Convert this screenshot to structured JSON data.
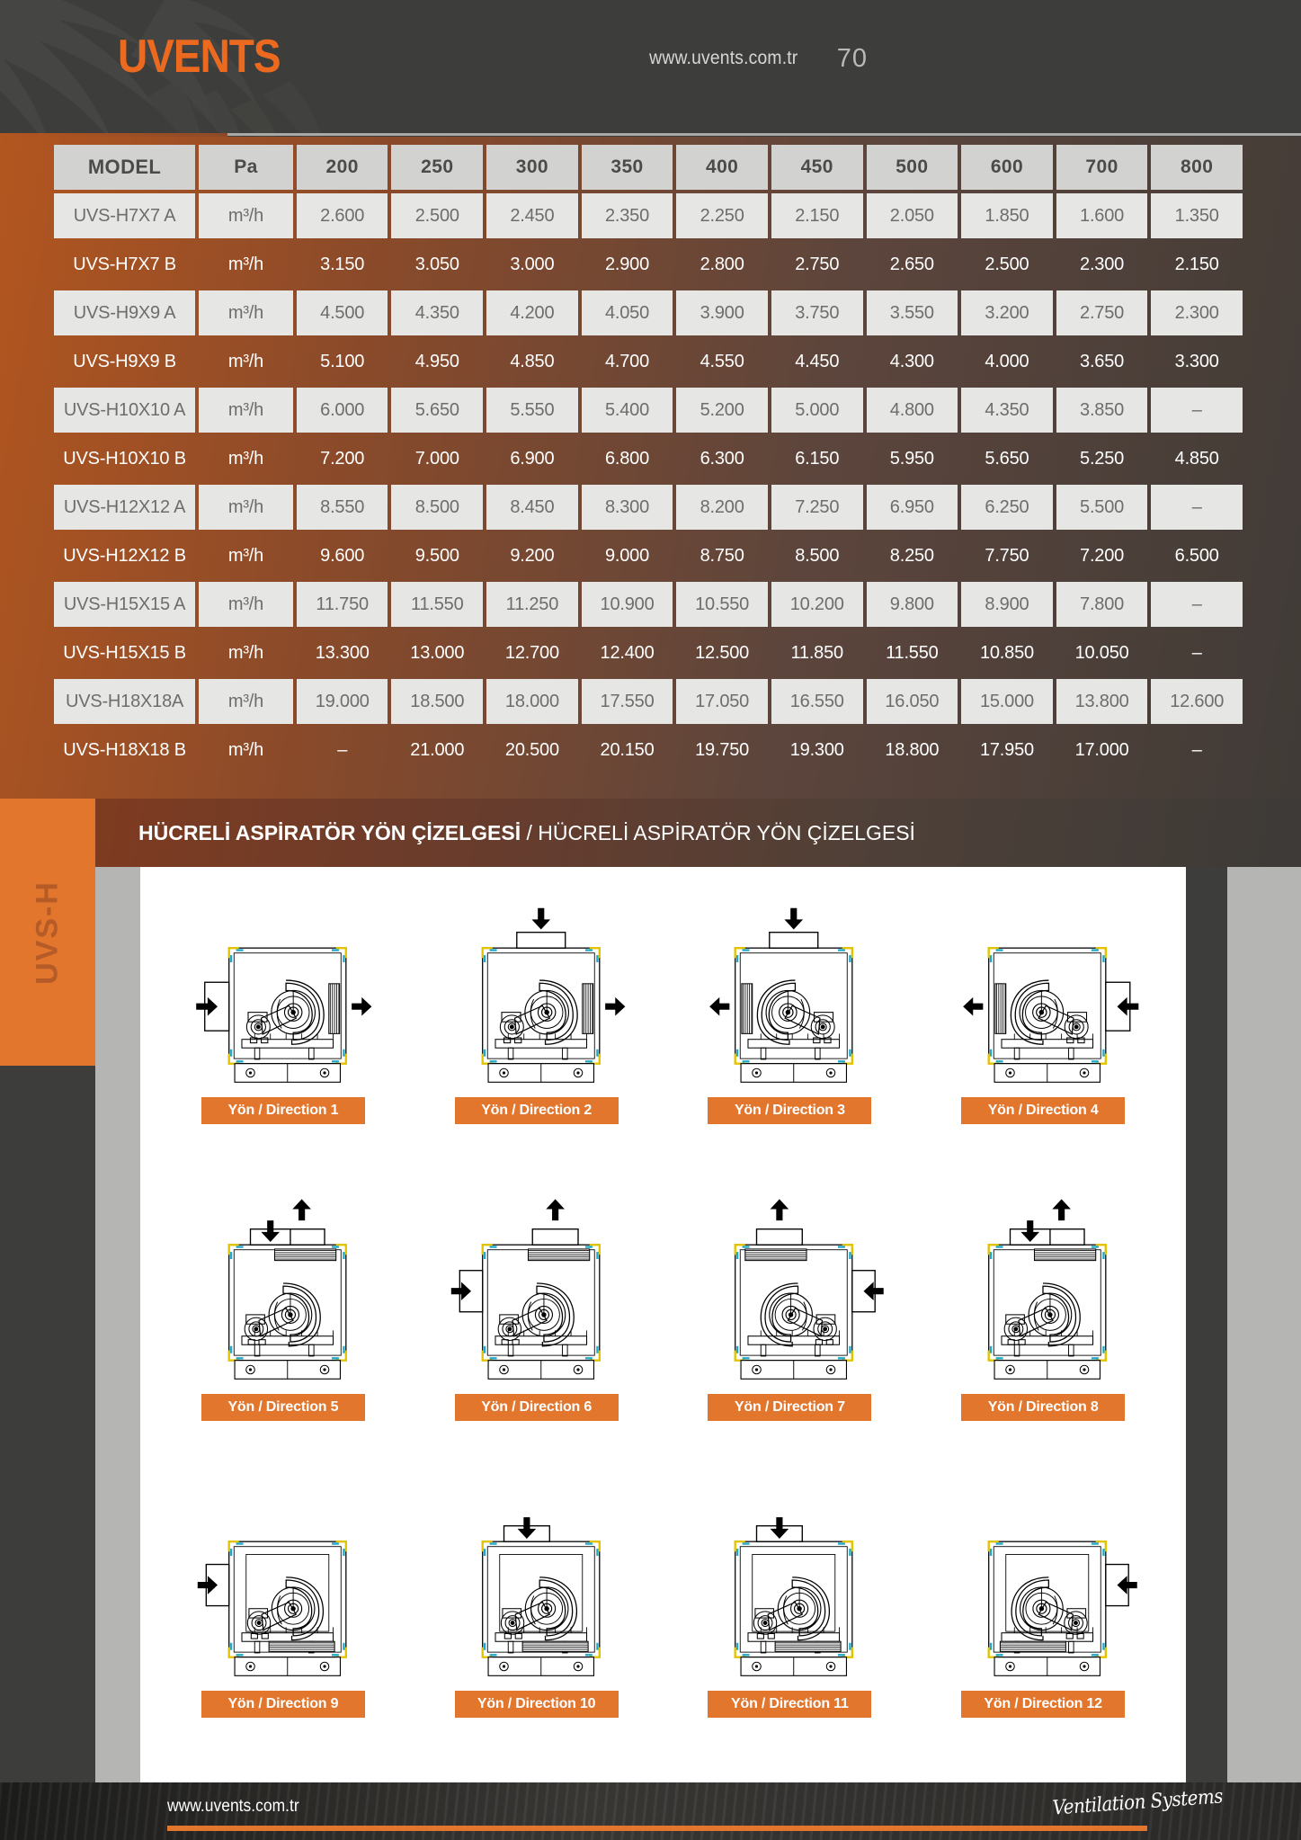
{
  "header": {
    "logo": "UVENTS",
    "url": "www.uvents.com.tr",
    "page_number": "70"
  },
  "side_tab": {
    "label": "UVS-H"
  },
  "section": {
    "title_bold": "HÜCRELİ ASPİRATÖR YÖN ÇİZELGESİ",
    "separator": " / ",
    "title_light": "HÜCRELİ ASPİRATÖR YÖN ÇİZELGESİ"
  },
  "table": {
    "headers": [
      "MODEL",
      "Pa",
      "200",
      "250",
      "300",
      "350",
      "400",
      "450",
      "500",
      "600",
      "700",
      "800"
    ],
    "rows": [
      {
        "model": "UVS-H7X7 A",
        "unit": "m³/h",
        "values": [
          "2.600",
          "2.500",
          "2.450",
          "2.350",
          "2.250",
          "2.150",
          "2.050",
          "1.850",
          "1.600",
          "1.350"
        ],
        "style": "light"
      },
      {
        "model": "UVS-H7X7 B",
        "unit": "m³/h",
        "values": [
          "3.150",
          "3.050",
          "3.000",
          "2.900",
          "2.800",
          "2.750",
          "2.650",
          "2.500",
          "2.300",
          "2.150"
        ],
        "style": "dark"
      },
      {
        "model": "UVS-H9X9 A",
        "unit": "m³/h",
        "values": [
          "4.500",
          "4.350",
          "4.200",
          "4.050",
          "3.900",
          "3.750",
          "3.550",
          "3.200",
          "2.750",
          "2.300"
        ],
        "style": "light"
      },
      {
        "model": "UVS-H9X9 B",
        "unit": "m³/h",
        "values": [
          "5.100",
          "4.950",
          "4.850",
          "4.700",
          "4.550",
          "4.450",
          "4.300",
          "4.000",
          "3.650",
          "3.300"
        ],
        "style": "dark"
      },
      {
        "model": "UVS-H10X10 A",
        "unit": "m³/h",
        "values": [
          "6.000",
          "5.650",
          "5.550",
          "5.400",
          "5.200",
          "5.000",
          "4.800",
          "4.350",
          "3.850",
          "–"
        ],
        "style": "light"
      },
      {
        "model": "UVS-H10X10 B",
        "unit": "m³/h",
        "values": [
          "7.200",
          "7.000",
          "6.900",
          "6.800",
          "6.300",
          "6.150",
          "5.950",
          "5.650",
          "5.250",
          "4.850"
        ],
        "style": "dark"
      },
      {
        "model": "UVS-H12X12 A",
        "unit": "m³/h",
        "values": [
          "8.550",
          "8.500",
          "8.450",
          "8.300",
          "8.200",
          "7.250",
          "6.950",
          "6.250",
          "5.500",
          "–"
        ],
        "style": "light"
      },
      {
        "model": "UVS-H12X12 B",
        "unit": "m³/h",
        "values": [
          "9.600",
          "9.500",
          "9.200",
          "9.000",
          "8.750",
          "8.500",
          "8.250",
          "7.750",
          "7.200",
          "6.500"
        ],
        "style": "dark"
      },
      {
        "model": "UVS-H15X15 A",
        "unit": "m³/h",
        "values": [
          "11.750",
          "11.550",
          "11.250",
          "10.900",
          "10.550",
          "10.200",
          "9.800",
          "8.900",
          "7.800",
          "–"
        ],
        "style": "light"
      },
      {
        "model": "UVS-H15X15 B",
        "unit": "m³/h",
        "values": [
          "13.300",
          "13.000",
          "12.700",
          "12.400",
          "12.500",
          "11.850",
          "11.550",
          "10.850",
          "10.050",
          "–"
        ],
        "style": "dark"
      },
      {
        "model": "UVS-H18X18A",
        "unit": "m³/h",
        "values": [
          "19.000",
          "18.500",
          "18.000",
          "17.550",
          "17.050",
          "16.550",
          "16.050",
          "15.000",
          "13.800",
          "12.600"
        ],
        "style": "light"
      },
      {
        "model": "UVS-H18X18 B",
        "unit": "m³/h",
        "values": [
          "–",
          "21.000",
          "20.500",
          "20.150",
          "19.750",
          "19.300",
          "18.800",
          "17.950",
          "17.000",
          "–"
        ],
        "style": "dark"
      }
    ]
  },
  "diagrams": [
    {
      "label": "Yön / Direction 1",
      "inlet": "left",
      "outlet": "right",
      "variant": "side"
    },
    {
      "label": "Yön / Direction 2",
      "inlet": "top",
      "outlet": "right",
      "variant": "side"
    },
    {
      "label": "Yön / Direction 3",
      "inlet": "top",
      "outlet": "left",
      "variant": "side"
    },
    {
      "label": "Yön / Direction 4",
      "inlet": "right",
      "outlet": "left",
      "variant": "side"
    },
    {
      "label": "Yön / Direction 5",
      "inlet": "top",
      "outlet": "topup",
      "variant": "up"
    },
    {
      "label": "Yön / Direction 6",
      "inlet": "left",
      "outlet": "topup",
      "variant": "up"
    },
    {
      "label": "Yön / Direction 7",
      "inlet": "right",
      "outlet": "topup",
      "variant": "up"
    },
    {
      "label": "Yön / Direction 8",
      "inlet": "top",
      "outlet": "topup",
      "variant": "up"
    },
    {
      "label": "Yön / Direction 9",
      "inlet": "left",
      "outlet": "down",
      "variant": "down"
    },
    {
      "label": "Yön / Direction 10",
      "inlet": "top",
      "outlet": "down",
      "variant": "down"
    },
    {
      "label": "Yön / Direction 11",
      "inlet": "top",
      "outlet": "down",
      "variant": "down"
    },
    {
      "label": "Yön / Direction 12",
      "inlet": "right",
      "outlet": "down",
      "variant": "down"
    }
  ],
  "footer": {
    "url": "www.uvents.com.tr",
    "script": "Ventilation Systems"
  },
  "colors": {
    "accent_orange": "#e3762d",
    "logo_orange": "#ec6a1f",
    "dark_bg": "#3d3d3b",
    "row_light": "#e6e6e4",
    "header_cell": "#d2d2d0"
  }
}
